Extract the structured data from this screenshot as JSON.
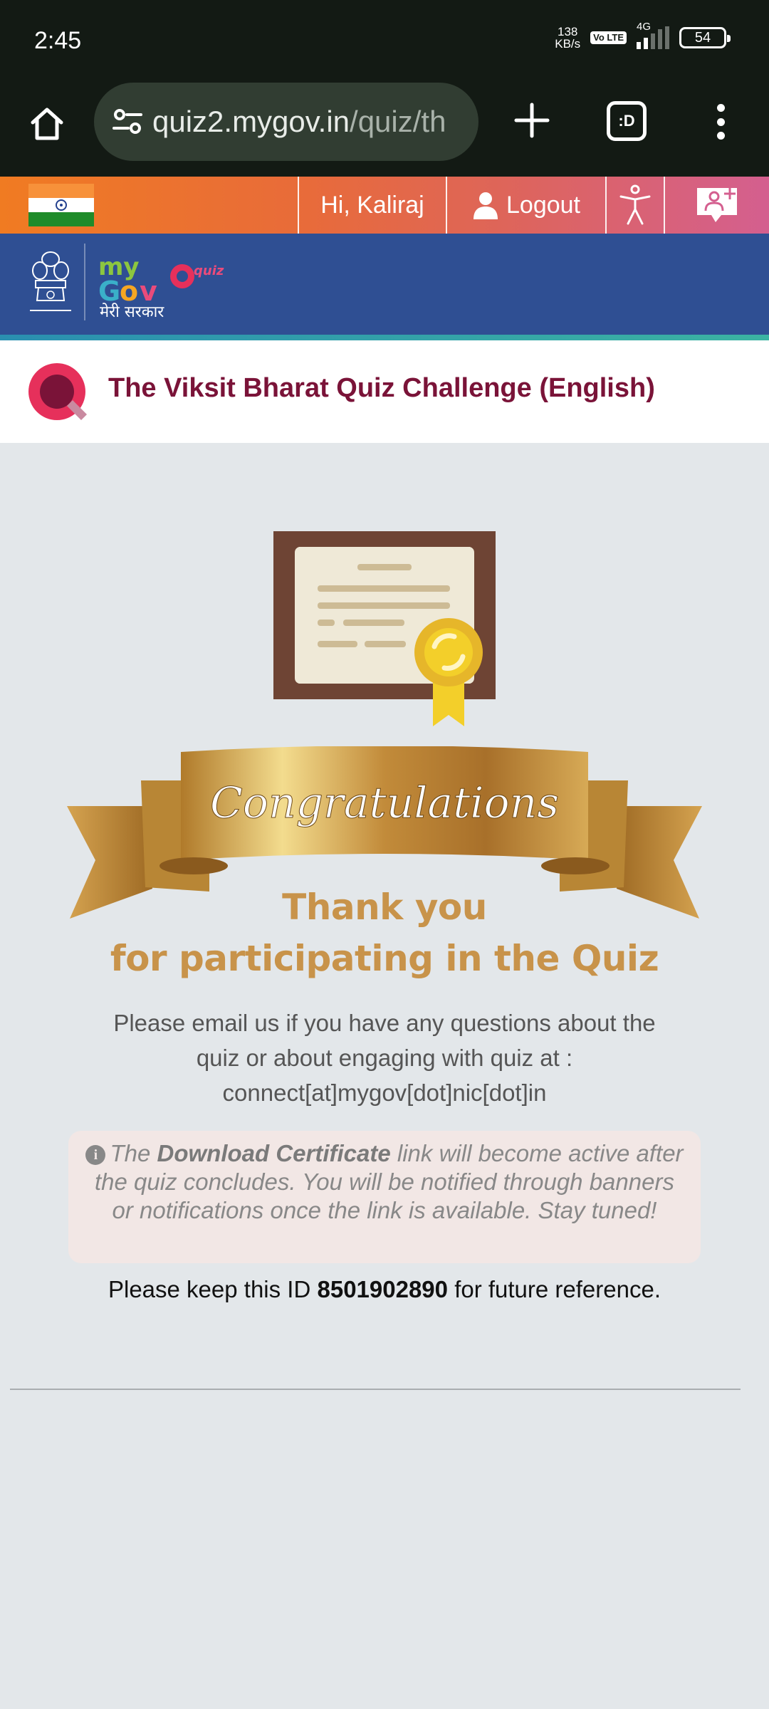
{
  "status_bar": {
    "time": "2:45",
    "net_speed_value": "138",
    "net_speed_unit": "KB/s",
    "volte": "Vo LTE",
    "network_type": "4G",
    "battery": "54"
  },
  "browser": {
    "url_host": "quiz2.mygov.in",
    "url_path": "/quiz/th",
    "tabs_label": ":D"
  },
  "top_band": {
    "greeting": "Hi, Kaliraj",
    "logout_label": "Logout"
  },
  "header": {
    "logo_subtitle": "मेरी सरकार"
  },
  "quiz": {
    "title": "The Viksit Bharat Quiz Challenge (English)"
  },
  "main": {
    "ribbon_text": "Congratulations",
    "thanks_line1": "Thank you",
    "thanks_line2": "for participating in the Quiz",
    "email_line1": "Please email us if you have any questions about the",
    "email_line2": "quiz or about engaging with quiz at :",
    "email_line3": "connect[at]mygov[dot]nic[dot]in",
    "notice_pre": "The",
    "notice_bold": "Download Certificate",
    "notice_post": "link will become active after the quiz concludes. You will be notified through banners or notifications once the link is available. Stay tuned!",
    "id_pre": "Please keep this ID",
    "id_value": "8501902890",
    "id_post": "for future reference."
  },
  "colors": {
    "brand_blue": "#2f4f93",
    "quiz_title": "#7a1338",
    "gold": "#c8934a"
  }
}
